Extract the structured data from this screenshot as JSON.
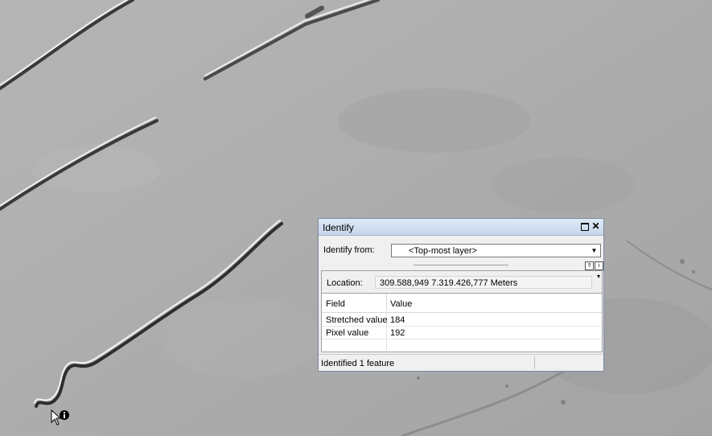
{
  "identify": {
    "title": "Identify",
    "identify_from_label": "Identify from:",
    "identify_from_value": "<Top-most layer>",
    "location_label": "Location:",
    "location_value": "309.588,949  7.319.426,777 Meters",
    "columns": [
      "Field",
      "Value"
    ],
    "rows": [
      {
        "field": "Stretched value",
        "value": "184"
      },
      {
        "field": "Pixel value",
        "value": "192"
      }
    ],
    "status": "Identified 1 feature"
  },
  "icons": {
    "restore": "restore-icon",
    "close": "close-icon",
    "dropdown": "chevron-down-icon",
    "cursor": "identify-cursor-icon"
  },
  "colors": {
    "map_background": "#a9a9a9",
    "titlebar": "#c6d6ec"
  }
}
